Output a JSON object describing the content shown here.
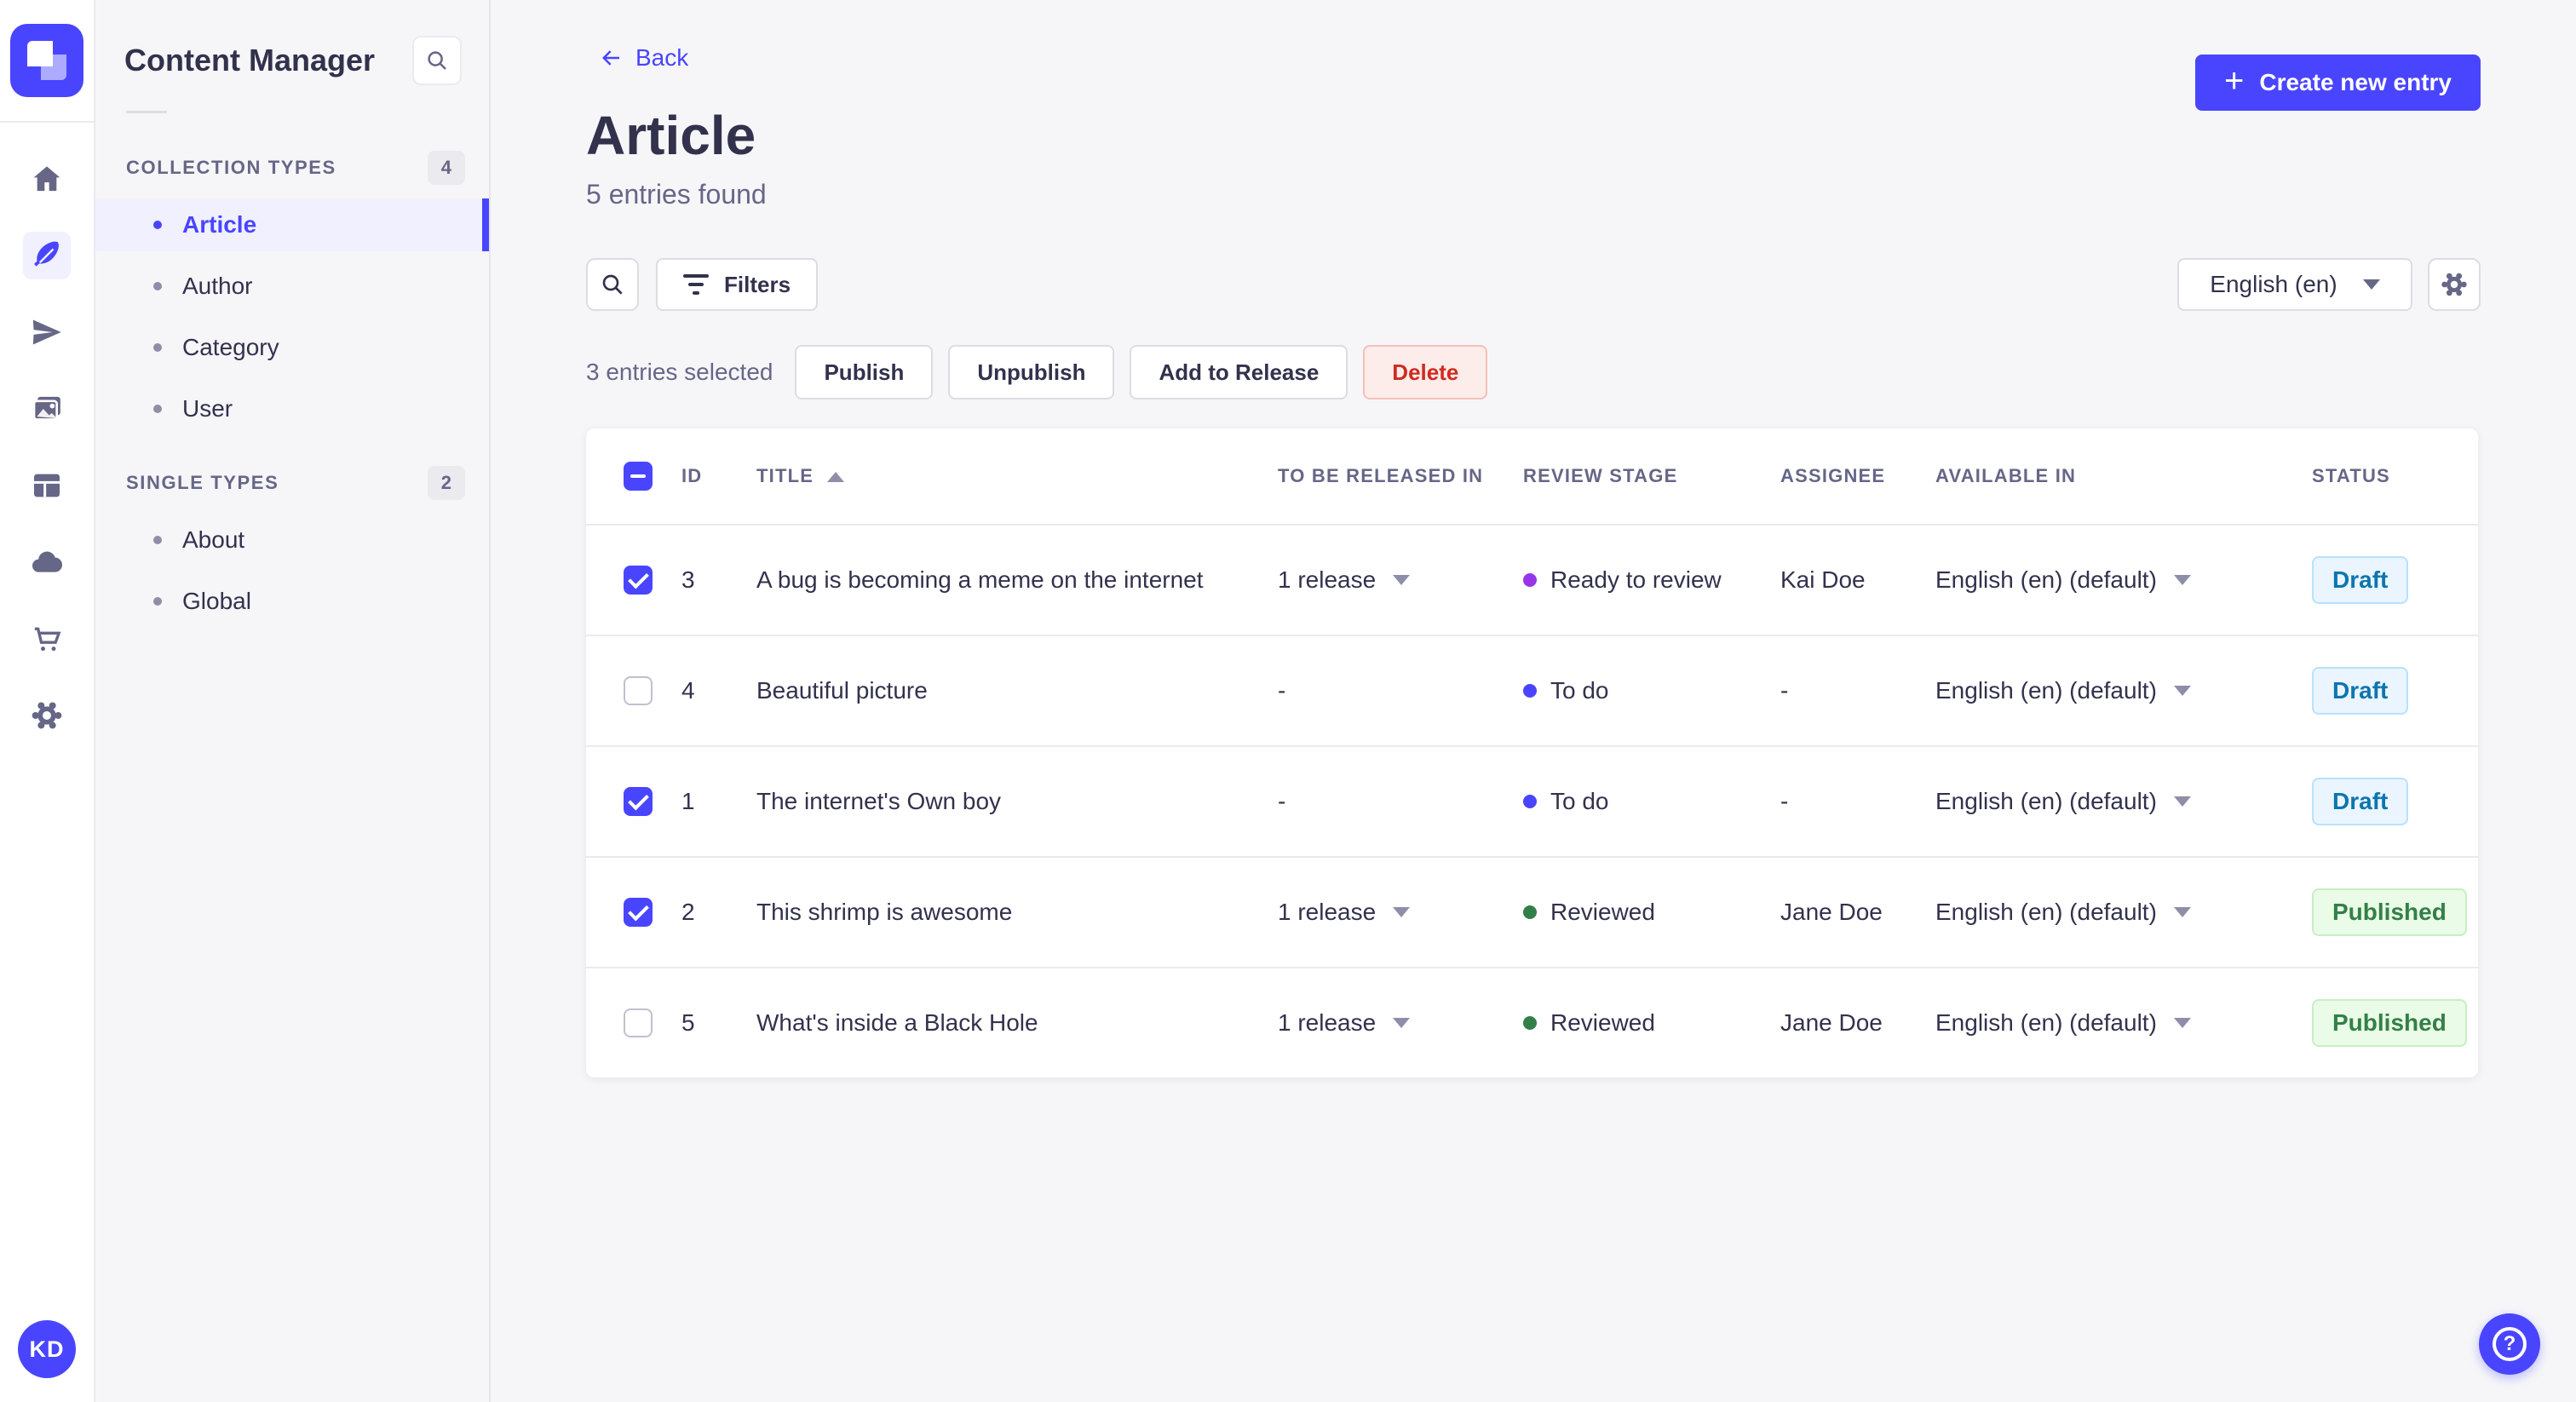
{
  "rail": {
    "icons": [
      "home-icon",
      "content-manager-icon",
      "releases-icon",
      "media-library-icon",
      "content-type-builder-icon",
      "deployments-icon",
      "marketplace-icon",
      "settings-icon"
    ],
    "active_icon": "content-manager-icon",
    "avatar_initials": "KD"
  },
  "subnav": {
    "title": "Content Manager",
    "sections": [
      {
        "label": "COLLECTION TYPES",
        "count": "4",
        "items": [
          {
            "label": "Article"
          },
          {
            "label": "Author"
          },
          {
            "label": "Category"
          },
          {
            "label": "User"
          }
        ],
        "active_item": "Article"
      },
      {
        "label": "SINGLE TYPES",
        "count": "2",
        "items": [
          {
            "label": "About"
          },
          {
            "label": "Global"
          }
        ]
      }
    ]
  },
  "header": {
    "back_label": "Back",
    "title": "Article",
    "subtitle": "5 entries found",
    "create_button_label": "Create new entry",
    "plus_glyph": "+"
  },
  "toolbar": {
    "filters_label": "Filters",
    "locale_value": "English (en)"
  },
  "selection": {
    "text": "3 entries selected",
    "publish_label": "Publish",
    "unpublish_label": "Unpublish",
    "add_to_release_label": "Add to Release",
    "delete_label": "Delete"
  },
  "table": {
    "select_all_state": "indeterminate",
    "columns": [
      "ID",
      "TITLE",
      "TO BE RELEASED IN",
      "REVIEW STAGE",
      "ASSIGNEE",
      "AVAILABLE IN",
      "STATUS"
    ],
    "sorted_column": "TITLE",
    "sort_direction": "asc",
    "rows": [
      {
        "checked": true,
        "id": "3",
        "title": "A bug is becoming a meme on the internet",
        "release": "1 release",
        "release_menu": true,
        "stage": "Ready to review",
        "stage_color": "#9736e8",
        "assignee": "Kai Doe",
        "locale": "English (en) (default)",
        "status": "Draft"
      },
      {
        "checked": false,
        "id": "4",
        "title": "Beautiful picture",
        "release": "-",
        "release_menu": false,
        "stage": "To do",
        "stage_color": "#4945ff",
        "assignee": "-",
        "locale": "English (en) (default)",
        "status": "Draft"
      },
      {
        "checked": true,
        "id": "1",
        "title": "The internet's Own boy",
        "release": "-",
        "release_menu": false,
        "stage": "To do",
        "stage_color": "#4945ff",
        "assignee": "-",
        "locale": "English (en) (default)",
        "status": "Draft"
      },
      {
        "checked": true,
        "id": "2",
        "title": "This shrimp is awesome",
        "release": "1 release",
        "release_menu": true,
        "stage": "Reviewed",
        "stage_color": "#328048",
        "assignee": "Jane Doe",
        "locale": "English (en) (default)",
        "status": "Published"
      },
      {
        "checked": false,
        "id": "5",
        "title": "What's inside a Black Hole",
        "release": "1 release",
        "release_menu": true,
        "stage": "Reviewed",
        "stage_color": "#328048",
        "assignee": "Jane Doe",
        "locale": "English (en) (default)",
        "status": "Published"
      }
    ]
  },
  "help": {
    "glyph": "?"
  },
  "colors": {
    "primary": "#4945ff",
    "draft_text": "#0c75af",
    "draft_bg": "#eaf5ff",
    "published_text": "#328048",
    "published_bg": "#eafbe7",
    "danger_text": "#d02b20"
  }
}
